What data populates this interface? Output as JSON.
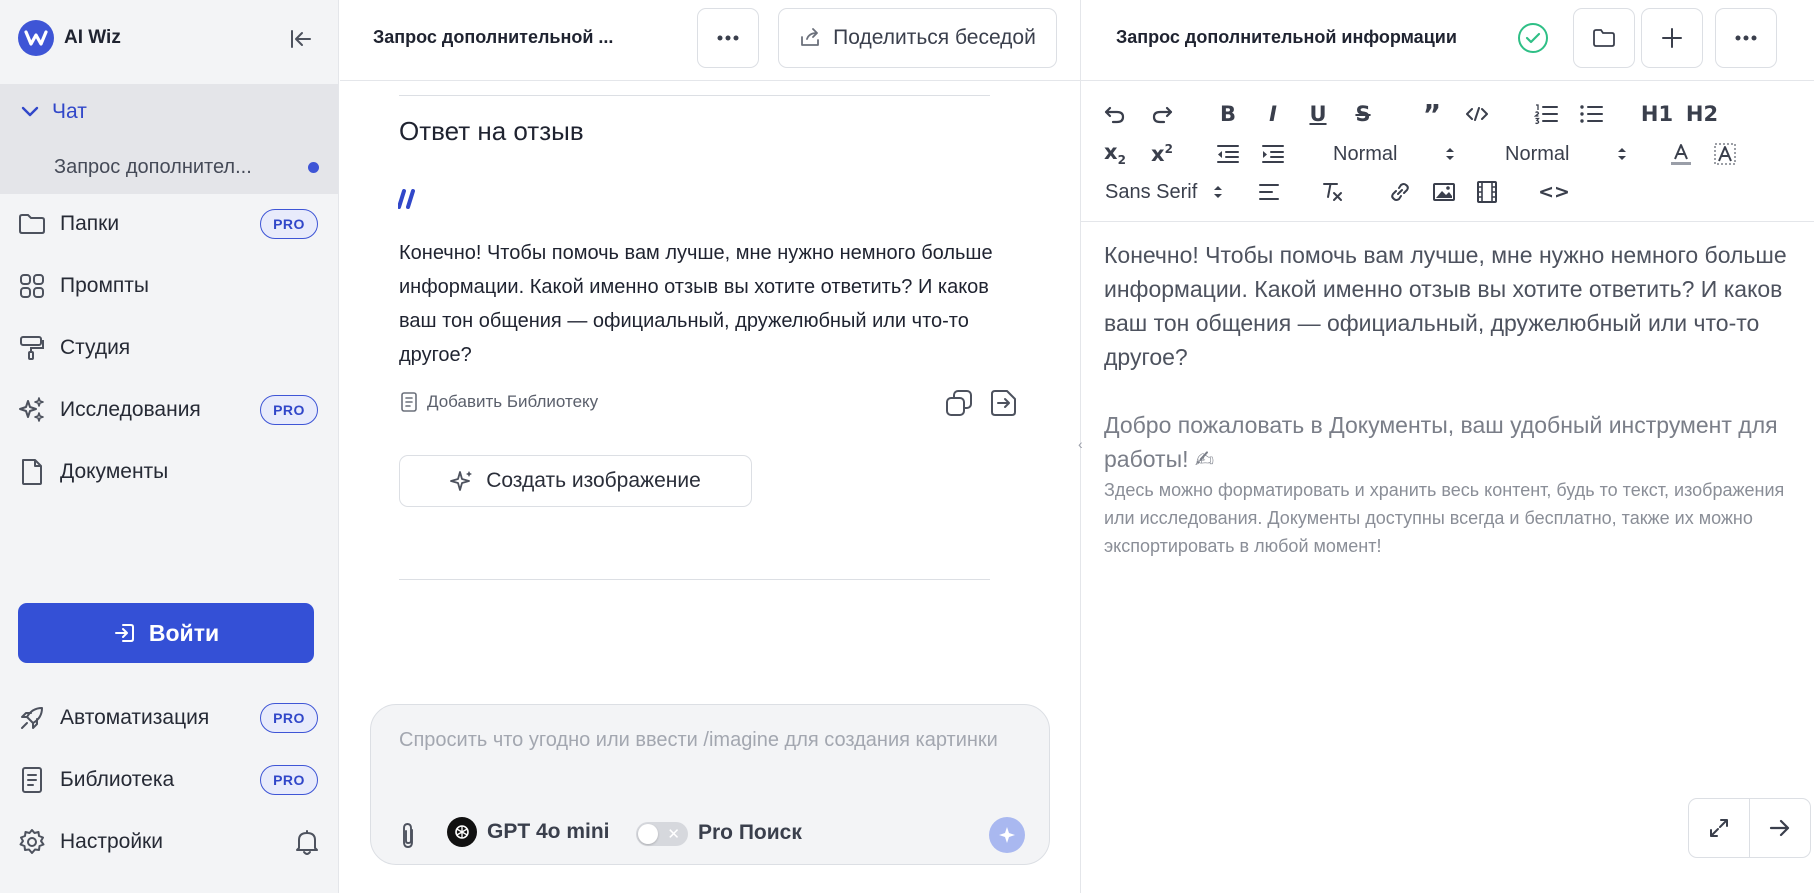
{
  "app": {
    "name": "AI Wiz"
  },
  "sidebar": {
    "chat_label": "Чат",
    "current_chat": "Запрос дополнител...",
    "items": [
      {
        "label": "Папки",
        "badge": "PRO",
        "icon": "folder-icon"
      },
      {
        "label": "Промпты",
        "badge": "",
        "icon": "grid-icon"
      },
      {
        "label": "Студия",
        "badge": "",
        "icon": "paint-roller-icon"
      },
      {
        "label": "Исследования",
        "badge": "PRO",
        "icon": "sparkles-icon"
      },
      {
        "label": "Документы",
        "badge": "",
        "icon": "document-icon"
      }
    ],
    "login_label": "Войти",
    "bottom_items": [
      {
        "label": "Автоматизация",
        "badge": "PRO",
        "icon": "rocket-icon"
      },
      {
        "label": "Библиотека",
        "badge": "PRO",
        "icon": "book-icon"
      },
      {
        "label": "Настройки",
        "badge": "",
        "icon": "gear-icon"
      }
    ]
  },
  "chat": {
    "title": "Запрос дополнительной ...",
    "share_label": "Поделиться беседой",
    "answer_title": "Ответ на отзыв",
    "answer_text": "Конечно! Чтобы помочь вам лучше, мне нужно немного больше информации. Какой именно отзыв вы хотите ответить? И каков ваш тон общения — официальный, дружелюбный или что-то другое?",
    "add_library_label": "Добавить Библиотеку",
    "generate_image_label": "Создать изображение"
  },
  "composer": {
    "placeholder": "Спросить что угодно или ввести /imagine для создания картинки",
    "model_label": "GPT 4o mini",
    "pro_search_label": "Pro Поиск",
    "pro_search_enabled": false
  },
  "document": {
    "title": "Запрос дополнительной информации",
    "toolbar": {
      "header_select": "Normal",
      "size_select": "Normal",
      "font_select": "Sans Serif",
      "h1": "H1",
      "h2": "H2"
    },
    "paragraph": "Конечно! Чтобы помочь вам лучше, мне нужно немного больше информации. Какой именно отзыв вы хотите ответить? И каков ваш тон общения — официальный, дружелюбный или что-то другое?",
    "welcome_title": "Добро пожаловать в Документы, ваш удобный инструмент для работы! ✍",
    "welcome_text": "Здесь можно форматировать и хранить весь контент, будь то текст, изображения или исследования. Документы доступны всегда и бесплатно, также их можно экспортировать в любой момент!"
  },
  "colors": {
    "accent": "#3450d6",
    "sidebar_bg": "#f3f4f6",
    "saved_check": "#2fbf86"
  }
}
